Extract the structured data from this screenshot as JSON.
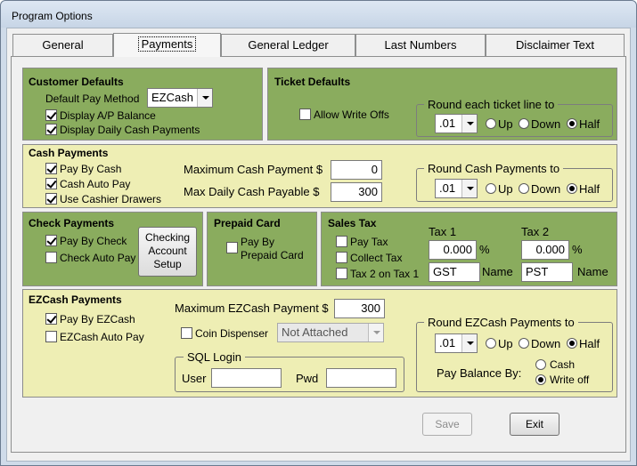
{
  "window": {
    "title": "Program Options"
  },
  "tabs": [
    "General",
    "Payments",
    "General Ledger",
    "Last Numbers",
    "Disclaimer Text"
  ],
  "customer_defaults": {
    "title": "Customer Defaults",
    "default_pay_method_label": "Default Pay Method",
    "default_pay_method_value": "EZCash",
    "display_ap_balance_label": "Display A/P Balance",
    "display_ap_balance_checked": true,
    "display_daily_cash_label": "Display Daily Cash Payments",
    "display_daily_cash_checked": true
  },
  "ticket_defaults": {
    "title": "Ticket Defaults",
    "allow_write_offs_label": "Allow Write Offs",
    "allow_write_offs_checked": false,
    "round_title": "Round each ticket line to",
    "round_value": ".01",
    "up_label": "Up",
    "down_label": "Down",
    "half_label": "Half",
    "selected": "Half"
  },
  "cash_payments": {
    "title": "Cash Payments",
    "pay_by_cash_label": "Pay By Cash",
    "cash_auto_pay_label": "Cash Auto Pay",
    "use_cashier_drawers_label": "Use Cashier Drawers",
    "max_cash_label": "Maximum Cash Payment $",
    "max_cash_value": "0",
    "max_daily_label": "Max Daily Cash Payable $",
    "max_daily_value": "300",
    "round_title": "Round Cash Payments to",
    "round_value": ".01",
    "up_label": "Up",
    "down_label": "Down",
    "half_label": "Half",
    "selected": "Half"
  },
  "check_payments": {
    "title": "Check Payments",
    "pay_by_check_label": "Pay By Check",
    "check_auto_pay_label": "Check Auto Pay",
    "setup_button": [
      "Checking",
      "Account",
      "Setup"
    ]
  },
  "prepaid_card": {
    "title": "Prepaid Card",
    "pay_by_label": [
      "Pay By",
      "Prepaid Card"
    ]
  },
  "sales_tax": {
    "title": "Sales Tax",
    "pay_tax_label": "Pay Tax",
    "collect_tax_label": "Collect Tax",
    "tax2_on_tax1_label": "Tax 2 on Tax 1",
    "tax1_label": "Tax 1",
    "tax2_label": "Tax 2",
    "tax1_value": "0.000",
    "tax2_value": "0.000",
    "percent": "%",
    "name1_value": "GST",
    "name2_value": "PST",
    "name_label": "Name"
  },
  "ezcash_payments": {
    "title": "EZCash Payments",
    "pay_by_ezcash_label": "Pay By EZCash",
    "ezcash_auto_pay_label": "EZCash Auto Pay",
    "max_label": "Maximum EZCash Payment $",
    "max_value": "300",
    "coin_dispenser_label": "Coin Dispenser",
    "coin_dispenser_value": "Not Attached",
    "sql_login_title": "SQL Login",
    "user_label": "User",
    "pwd_label": "Pwd",
    "round_title": "Round EZCash Payments to",
    "round_value": ".01",
    "up_label": "Up",
    "down_label": "Down",
    "half_label": "Half",
    "selected": "Half",
    "pay_balance_label": "Pay Balance By:",
    "cash_label": "Cash",
    "write_off_label": "Write off",
    "pay_balance_selected": "Write off"
  },
  "buttons": {
    "save_label": "Save",
    "exit_label": "Exit"
  },
  "colors": {
    "green_panel": "#8aac5e",
    "cream_panel": "#eeeeb4"
  }
}
